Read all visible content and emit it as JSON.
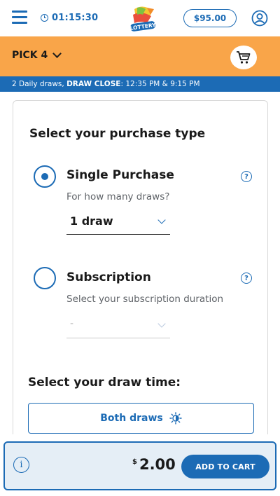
{
  "header": {
    "countdown": "01:15:30",
    "balance": "$95.00",
    "logo_text": "LOTTERY"
  },
  "game": {
    "title": "PICK 4"
  },
  "draw_info": {
    "prefix": "2 Daily draws,",
    "close_label": "DRAW CLOSE",
    "times": ": 12:35 PM & 9:15 PM"
  },
  "purchase": {
    "heading": "Select your purchase type",
    "options": [
      {
        "title": "Single Purchase",
        "subtitle": "For how many draws?",
        "selected_value": "1 draw",
        "help": "?",
        "checked": true
      },
      {
        "title": "Subscription",
        "subtitle": "Select your subscription duration",
        "selected_value": "-",
        "help": "?",
        "checked": false
      }
    ]
  },
  "draw_time": {
    "heading": "Select your draw time:",
    "button_label": "Both draws"
  },
  "footer": {
    "info": "i",
    "currency": "$",
    "amount": "2.00",
    "add_to_cart": "ADD TO CART"
  },
  "colors": {
    "primary": "#1c6bb5",
    "accent": "#f9a549"
  },
  "icons": [
    "menu-icon",
    "clock-icon",
    "lottery-logo",
    "profile-icon",
    "chevron-down-icon",
    "cart-icon",
    "help-icon",
    "sun-moon-icon",
    "info-icon"
  ]
}
